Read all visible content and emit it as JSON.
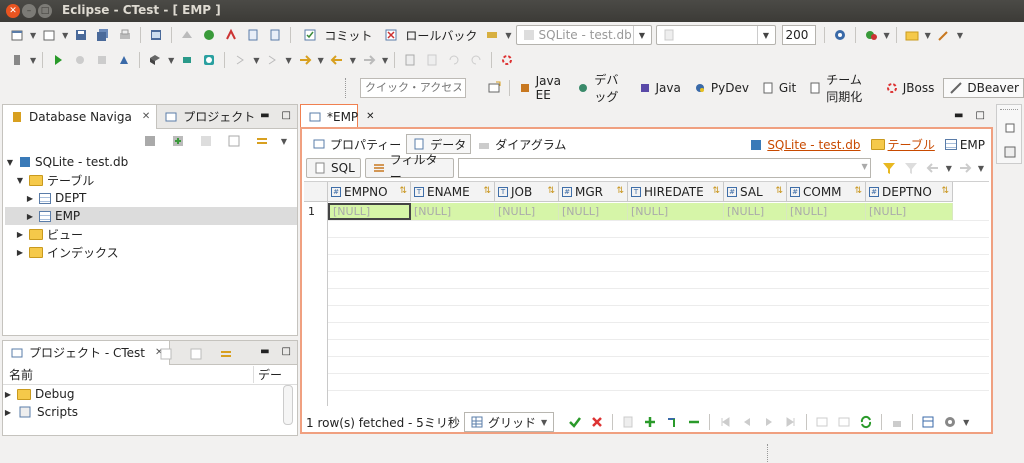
{
  "window": {
    "title": "Eclipse - CTest - [ EMP ]"
  },
  "toolbar": {
    "commit": "コミット",
    "rollback": "ロールバック",
    "connection": "SQLite - test.db",
    "database": "",
    "maxrows": "200"
  },
  "quick_access": {
    "placeholder": "クイック・アクセス"
  },
  "perspectives": [
    "Java EE",
    "デバッグ",
    "Java",
    "PyDev",
    "Git",
    "チーム同期化",
    "JBoss",
    "DBeaver"
  ],
  "navigator": {
    "tab_active": "Database Naviga",
    "tab_other": "プロジェクト",
    "tree": [
      {
        "label": "SQLite - test.db",
        "level": 0,
        "open": true
      },
      {
        "label": "テーブル",
        "level": 1,
        "open": true
      },
      {
        "label": "DEPT",
        "level": 2,
        "open": false
      },
      {
        "label": "EMP",
        "level": 2,
        "open": false,
        "selected": true
      },
      {
        "label": "ビュー",
        "level": 1,
        "open": false
      },
      {
        "label": "インデックス",
        "level": 1,
        "open": false
      }
    ]
  },
  "project_panel": {
    "title": "プロジェクト - CTest",
    "col_name": "名前",
    "col_data": "デー",
    "items": [
      "Debug",
      "Scripts"
    ]
  },
  "editor": {
    "tab": "*EMP",
    "subtabs": [
      "プロパティー",
      "データ",
      "ダイアグラム"
    ],
    "link_connection": "SQLite - test.db",
    "link_table": "テーブル",
    "entity": "EMP",
    "sql_button": "SQL",
    "filter_button": "フィルター",
    "columns": [
      "EMPNO",
      "ENAME",
      "JOB",
      "MGR",
      "HIREDATE",
      "SAL",
      "COMM",
      "DEPTNO"
    ],
    "row_number": "1",
    "null_text": "[NULL]",
    "status": "1 row(s) fetched - 5ミリ秒",
    "view_mode": "グリッド"
  }
}
